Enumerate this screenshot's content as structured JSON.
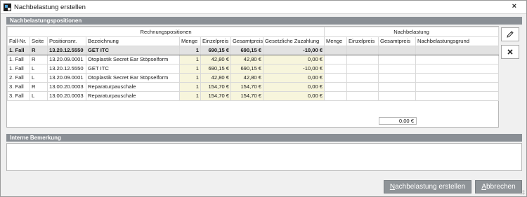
{
  "window": {
    "title": "Nachbelastung erstellen",
    "close_label": "×"
  },
  "sections": {
    "positions": "Nachbelastungspositionen",
    "remarks": "Interne Bemerkung"
  },
  "table": {
    "group_left": "Rechnungspositionen",
    "group_right": "Nachbelastung",
    "columns": [
      "Fall-Nr.",
      "Seite",
      "Positionsnr.",
      "Bezeichnung",
      "Menge",
      "Einzelpreis",
      "Gesamtpreis",
      "Gesetzliche Zuzahlung",
      "Menge",
      "Einzelpreis",
      "Gesamtpreis",
      "Nachbelastungsgrund"
    ],
    "rows": [
      [
        "1. Fall",
        "R",
        "13.20.12.5550",
        "GET ITC",
        "1",
        "690,15 €",
        "690,15 €",
        "-10,00 €",
        "",
        "",
        "",
        ""
      ],
      [
        "1. Fall",
        "R",
        "13.20.09.0001",
        "Otoplastik Secret Ear Stöpselform",
        "1",
        "42,80 €",
        "42,80 €",
        "0,00 €",
        "",
        "",
        "",
        ""
      ],
      [
        "1. Fall",
        "L",
        "13.20.12.5550",
        "GET ITC",
        "1",
        "690,15 €",
        "690,15 €",
        "-10,00 €",
        "",
        "",
        "",
        ""
      ],
      [
        "2. Fall",
        "L",
        "13.20.09.0001",
        "Otoplastik Secret Ear Stöpselform",
        "1",
        "42,80 €",
        "42,80 €",
        "0,00 €",
        "",
        "",
        "",
        ""
      ],
      [
        "3. Fall",
        "R",
        "13.00.20.0003",
        "Reparaturpauschale",
        "1",
        "154,70 €",
        "154,70 €",
        "0,00 €",
        "",
        "",
        "",
        ""
      ],
      [
        "3. Fall",
        "L",
        "13.00.20.0003",
        "Reparaturpauschale",
        "1",
        "154,70 €",
        "154,70 €",
        "0,00 €",
        "",
        "",
        "",
        ""
      ]
    ],
    "selected_row": 0,
    "total": "0,00 €"
  },
  "side_buttons": {
    "edit_icon": "pencil-icon",
    "delete_icon": "x-icon"
  },
  "remarks_value": "",
  "buttons": {
    "create_prefix": "",
    "create_underlined": "N",
    "create_rest": "achbelastung erstellen",
    "cancel_prefix": "",
    "cancel_underlined": "A",
    "cancel_rest": "bbrechen"
  }
}
